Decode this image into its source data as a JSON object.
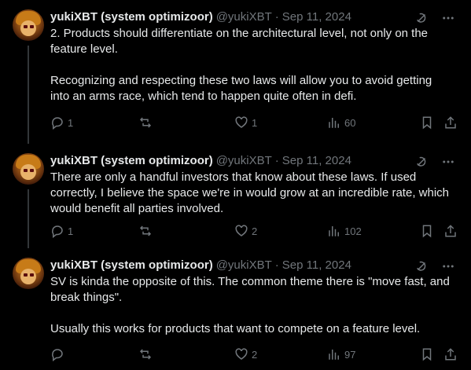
{
  "tweets": [
    {
      "author_name": "yukiXBT (system optimizoor)",
      "handle": "@yukiXBT",
      "separator": "·",
      "date": "Sep 11, 2024",
      "text": "2. Products should differentiate on the architectural level, not only on the feature level.\n\nRecognizing and respecting these two laws will allow you to avoid getting into an arms race, which tend to happen quite often in defi.",
      "replies": "1",
      "retweets": "",
      "likes": "1",
      "views": "60"
    },
    {
      "author_name": "yukiXBT (system optimizoor)",
      "handle": "@yukiXBT",
      "separator": "·",
      "date": "Sep 11, 2024",
      "text": "There are only a handful investors that know about these laws. If used correctly, I believe the space we're in would grow at an incredible rate, which would benefit all parties involved.",
      "replies": "1",
      "retweets": "",
      "likes": "2",
      "views": "102"
    },
    {
      "author_name": "yukiXBT (system optimizoor)",
      "handle": "@yukiXBT",
      "separator": "·",
      "date": "Sep 11, 2024",
      "text": "SV is kinda the opposite of this. The common theme there is \"move fast, and break things\".\n\nUsually this works for products that want to compete on a feature level.",
      "replies": "",
      "retweets": "",
      "likes": "2",
      "views": "97"
    }
  ],
  "icons": {
    "grok": "grok-icon",
    "more": "more-icon",
    "reply": "reply-icon",
    "retweet": "retweet-icon",
    "like": "like-icon",
    "views": "views-icon",
    "bookmark": "bookmark-icon",
    "share": "share-icon"
  },
  "colors": {
    "background": "#000000",
    "text": "#e7e9ea",
    "muted": "#71767b",
    "thread_line": "#333639"
  }
}
